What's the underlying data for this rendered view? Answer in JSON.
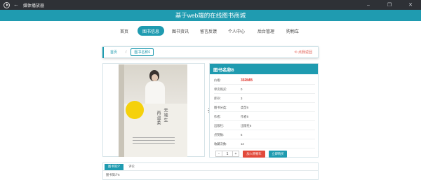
{
  "window": {
    "app_title": "媒体播放器",
    "controls": [
      "–",
      "❐",
      "✕"
    ]
  },
  "site": {
    "title": "基于web端的在线图书商城"
  },
  "nav": {
    "items": [
      {
        "label": "首页"
      },
      {
        "label": "图书信息"
      },
      {
        "label": "图书资讯"
      },
      {
        "label": "留言反馈"
      },
      {
        "label": "个人中心"
      },
      {
        "label": "后台管理"
      },
      {
        "label": "购物车"
      }
    ],
    "active_index": 1
  },
  "breadcrumb": {
    "home": "首页",
    "separator": "/",
    "current": "图书名称6",
    "back": "⟲ 点我返回"
  },
  "book_cover": {
    "title_line1": "无端生",
    "title_line2": "再温柔"
  },
  "detail": {
    "header": "图书名称6",
    "rows": [
      {
        "label": "价格:",
        "value": "35RMB"
      },
      {
        "label": "单次购买:",
        "value": "0"
      },
      {
        "label": "库存:",
        "value": "3"
      },
      {
        "label": "图书分类:",
        "value": "类型6"
      },
      {
        "label": "作者:",
        "value": "作者6"
      },
      {
        "label": "出版社:",
        "value": "出版社6"
      },
      {
        "label": "点赞数:",
        "value": "6"
      },
      {
        "label": "收藏次数:",
        "value": "12"
      }
    ],
    "quantity": "1",
    "minus": "-",
    "plus": "+",
    "add_to_cart": "加入购物车",
    "buy_now": "立即购买"
  },
  "tabs": {
    "items": [
      {
        "label": "图书简介"
      },
      {
        "label": "评论"
      }
    ],
    "content": "图书简介6"
  },
  "colors": {
    "accent": "#1f9bb0",
    "price": "#e0342c",
    "cart_button": "#e24a3b",
    "titlebar": "#2e3136"
  }
}
